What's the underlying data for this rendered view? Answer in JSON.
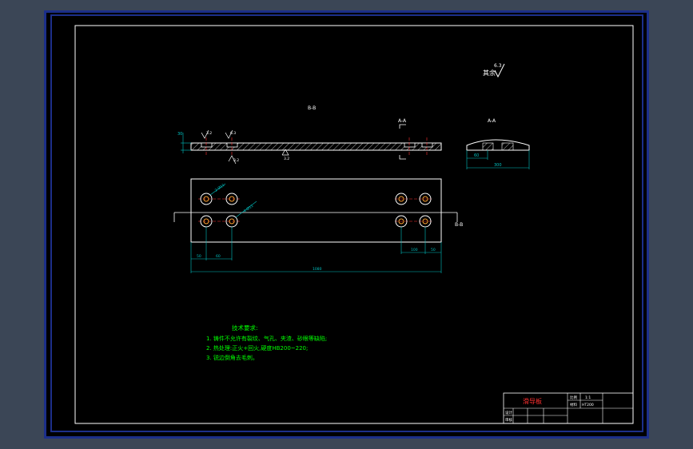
{
  "labels": {
    "roughness": "其余",
    "roughness_value": "6.3",
    "section_bb_top": "B-B",
    "section_aa_top": "A-A",
    "section_aa_right": "A-A",
    "section_bb_side": "B-B",
    "roughness_small_1": "3.2",
    "roughness_small_2": "6.3",
    "roughness_small_3": "3.2",
    "roughness_small_4": "3.2"
  },
  "dimensions": {
    "thickness": "30",
    "end_left": "50",
    "end_mid": "60",
    "total_length": "1080",
    "right_pitch": "100",
    "right_edge": "50",
    "profile_left": "60",
    "profile_width": "300",
    "hole_callout_1": "2-Ø11",
    "hole_callout_2": "4-Ø11"
  },
  "notes": {
    "title": "技术要求:",
    "items": [
      "1. 铸件不允许有裂纹、气孔、夹渣、砂眼等缺陷;",
      "2. 热处理:正火+回火,硬度HB200~220;",
      "3. 锐边倒角去毛刺。"
    ]
  },
  "title_block": {
    "part_name": "滑导板",
    "cell_1": "比例",
    "cell_2": "1:1",
    "cell_3": "材料",
    "cell_4": "HT200",
    "row_design": "设计",
    "row_check": "审核"
  },
  "colors": {
    "background": "#000000",
    "frame": "#ffffff",
    "dimension": "#00c0c0",
    "notes": "#00ff00",
    "centerline": "#ff3030",
    "title": "#ff3030"
  }
}
